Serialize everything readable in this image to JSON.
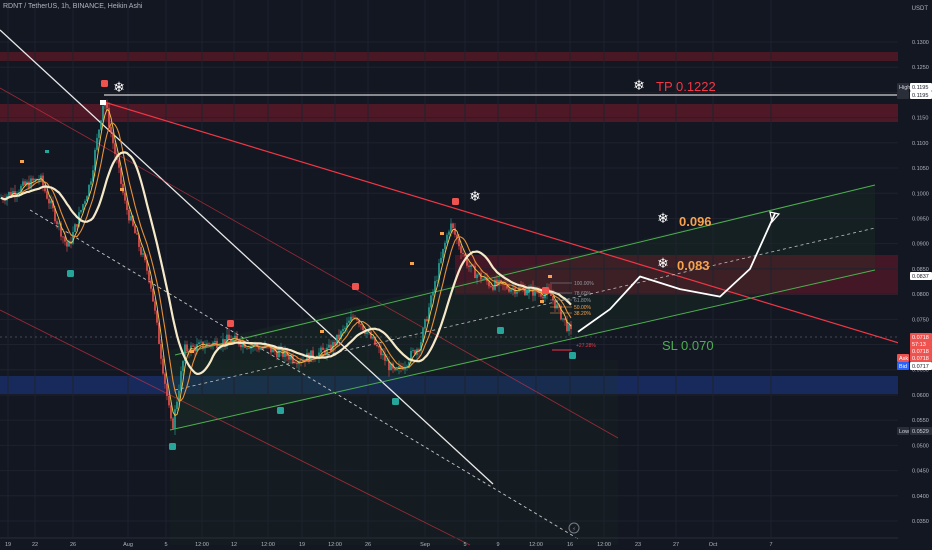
{
  "header": {
    "symbol_line": "RDNT / TetherUS, 1h, BINANCE, Heikin Ashi"
  },
  "axis": {
    "currency": "USDT",
    "price_ticks": [
      "0.1300",
      "0.1250",
      "0.1200",
      "0.1150",
      "0.1100",
      "0.1050",
      "0.1000",
      "0.0950",
      "0.0900",
      "0.0850",
      "0.0800",
      "0.0750",
      "0.0700",
      "0.0650",
      "0.0600",
      "0.0550",
      "0.0500",
      "0.0450",
      "0.0400",
      "0.0350"
    ],
    "time_ticks": [
      "19",
      "22",
      "26",
      "Aug",
      "5",
      "12:00",
      "12",
      "12:00",
      "19",
      "12:00",
      "26",
      "Sep",
      "5",
      "9",
      "12:00",
      "16",
      "12:00",
      "23",
      "27",
      "Oct",
      "7"
    ]
  },
  "badges": {
    "high_label": "High",
    "high_value": "0.1195",
    "low_label": "Low",
    "low_value": "0.0529",
    "price_value": "0.0837",
    "last_values": [
      "0.0718",
      "57:13",
      "0.0718",
      "0.0716"
    ],
    "ask_label": "Ask",
    "ask_value": "0.0718",
    "bid_label": "Bid",
    "bid_value": "0.0717"
  },
  "annotations": {
    "tp": "TP 0.1222",
    "t1": "0.096",
    "t2": "0.083",
    "sl": "SL 0.070",
    "pct": "+27.28%",
    "fib": [
      "100.00%",
      "78.60%",
      "61.80%",
      "50.00%",
      "38.20%"
    ]
  },
  "colors": {
    "background": "#131722",
    "up": "#26a69a",
    "down": "#ef5350",
    "tp_text": "#f23645",
    "target_text": "#f7a24d",
    "sl_text": "#4caf50",
    "resistance_zone": "#8b1a2a",
    "support_zone": "#1e3a8a",
    "channel": "#4caf50",
    "trendline_red": "#f23645"
  },
  "chart_data": {
    "type": "candlestick",
    "title": "RDNT / TetherUS, 1h, BINANCE, Heikin Ashi",
    "ylim": [
      0.033,
      0.1335
    ],
    "x": [
      "19",
      "22",
      "26",
      "Aug",
      "5",
      "12:00",
      "12",
      "12:00",
      "19",
      "12:00",
      "26",
      "Sep",
      "5",
      "9",
      "12:00",
      "16",
      "12:00",
      "23",
      "27",
      "Oct",
      "7"
    ],
    "price_path": [
      [
        0,
        0.099
      ],
      [
        40,
        0.103
      ],
      [
        68,
        0.089
      ],
      [
        90,
        0.102
      ],
      [
        104,
        0.119
      ],
      [
        125,
        0.098
      ],
      [
        150,
        0.083
      ],
      [
        172,
        0.053
      ],
      [
        185,
        0.069
      ],
      [
        230,
        0.071
      ],
      [
        270,
        0.069
      ],
      [
        300,
        0.067
      ],
      [
        330,
        0.069
      ],
      [
        355,
        0.076
      ],
      [
        395,
        0.064
      ],
      [
        420,
        0.07
      ],
      [
        450,
        0.094
      ],
      [
        470,
        0.085
      ],
      [
        490,
        0.082
      ],
      [
        520,
        0.081
      ],
      [
        550,
        0.08
      ],
      [
        572,
        0.0718
      ]
    ],
    "projection_path": [
      [
        578,
        0.0725
      ],
      [
        610,
        0.077
      ],
      [
        640,
        0.0835
      ],
      [
        680,
        0.081
      ],
      [
        720,
        0.0795
      ],
      [
        750,
        0.085
      ],
      [
        775,
        0.096
      ]
    ],
    "levels": {
      "tp": 0.1222,
      "target_1": 0.096,
      "target_2": 0.083,
      "sl": 0.07,
      "high": 0.1195,
      "low": 0.0529,
      "last": 0.0718
    }
  }
}
